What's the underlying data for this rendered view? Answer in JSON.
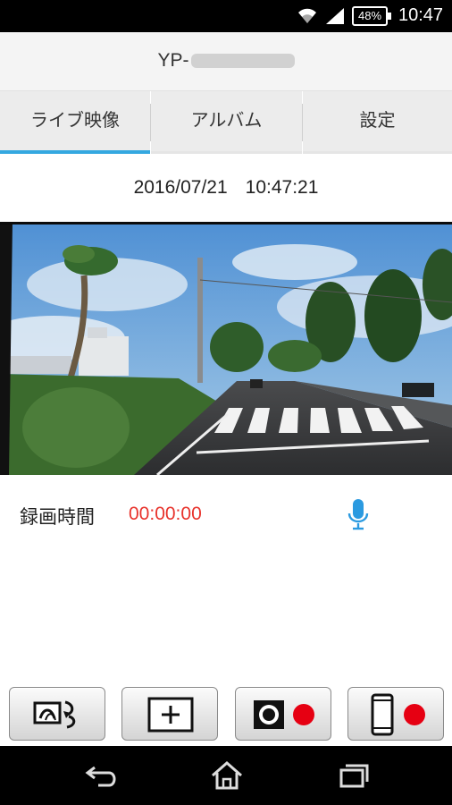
{
  "status_bar": {
    "battery": "48%",
    "time": "10:47",
    "icons": [
      "wifi-icon",
      "signal-icon",
      "battery-icon"
    ]
  },
  "title_bar": {
    "device_prefix": "YP-"
  },
  "tabs": [
    {
      "label": "ライブ映像",
      "selected": true
    },
    {
      "label": "アルバム",
      "selected": false
    },
    {
      "label": "設定",
      "selected": false
    }
  ],
  "datetime": {
    "date": "2016/07/21",
    "time": "10:47:21"
  },
  "video": {
    "description_icon": "live-camera-feed"
  },
  "recording": {
    "label": "録画時間",
    "elapsed": "00:00:00",
    "mic_icon": "microphone-icon"
  },
  "buttons": [
    {
      "icon": "switch-camera-icon"
    },
    {
      "icon": "add-icon"
    },
    {
      "icon": "camera-record-icon"
    },
    {
      "icon": "phone-record-icon"
    }
  ],
  "nav_bar": {
    "icons": [
      "back-icon",
      "home-icon",
      "recent-apps-icon"
    ]
  },
  "colors": {
    "accent": "#34a8e0",
    "recording_time": "#e8332c",
    "record_dot": "#e60012"
  }
}
